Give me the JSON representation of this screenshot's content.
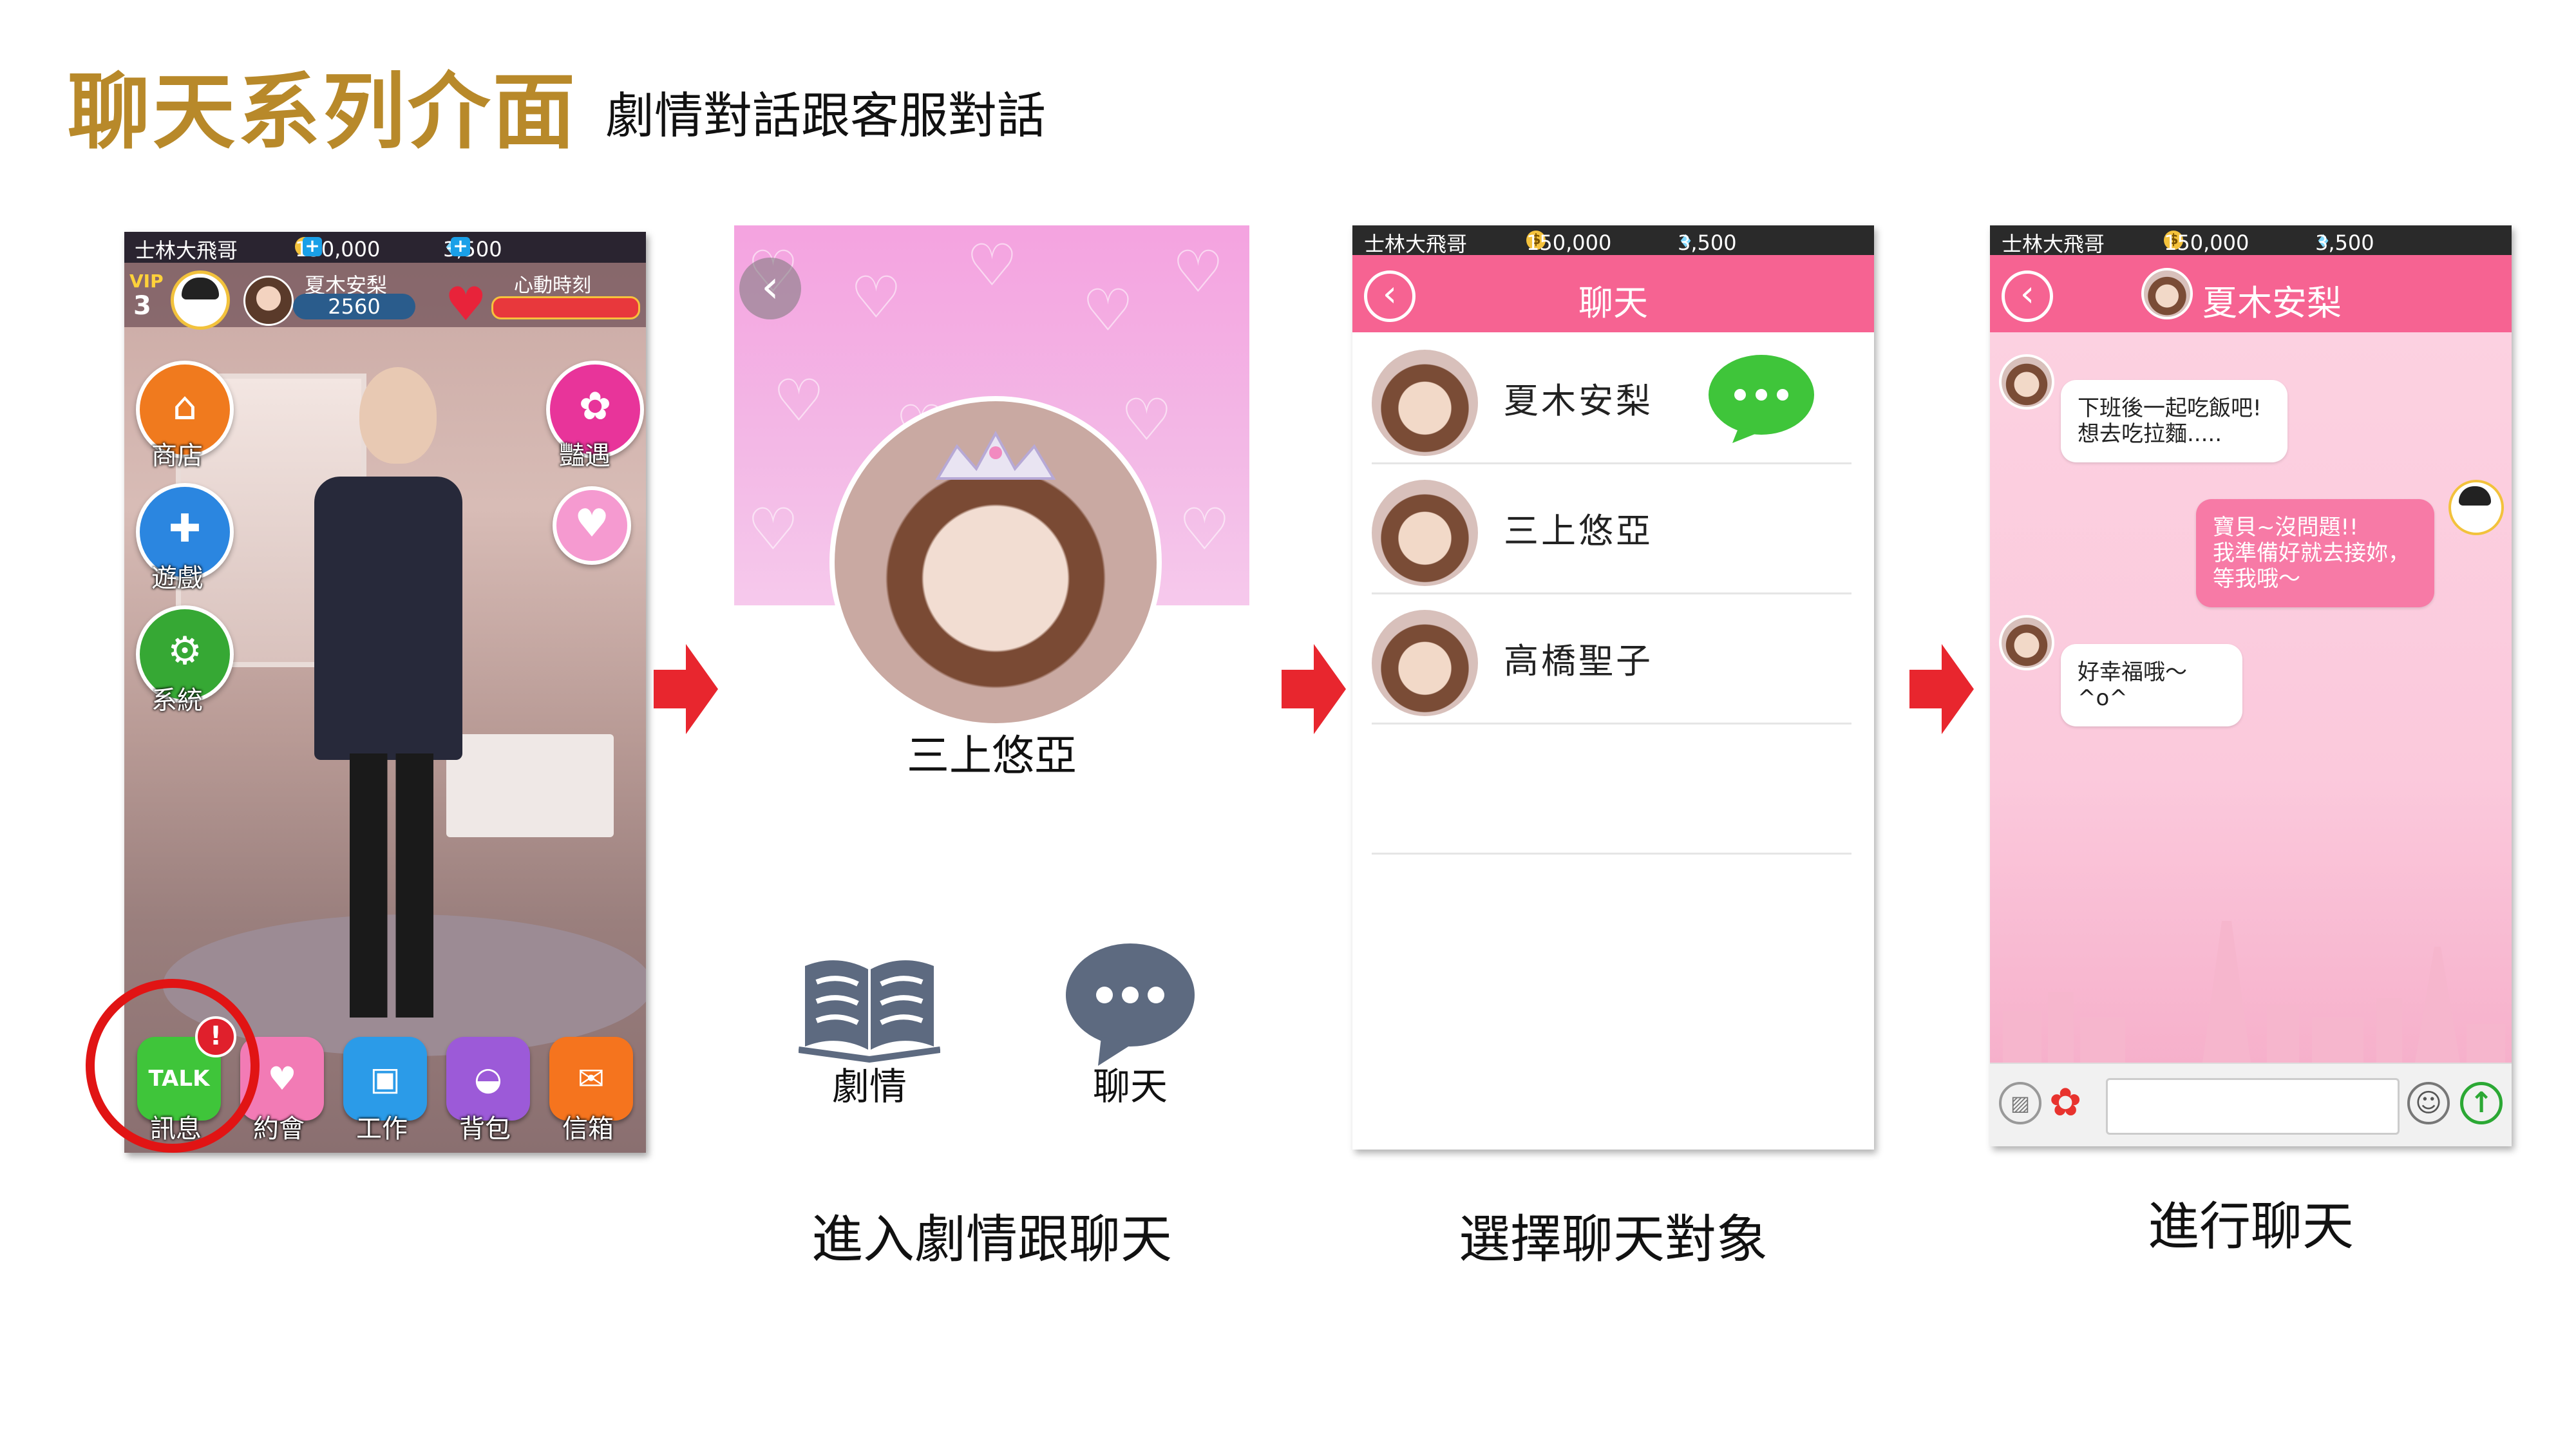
{
  "title": "聊天系列介面",
  "subtitle": "劇情對話跟客服對話",
  "status": {
    "player": "士林大飛哥",
    "coins": "150,000",
    "gems": "3,500"
  },
  "home": {
    "vip_label": "VIP",
    "vip_level": "3",
    "heroine_name": "夏木安梨",
    "heroine_score": "2560",
    "love_label": "心動時刻",
    "side_buttons": [
      "商店",
      "遊戲",
      "系統",
      "豔遇"
    ],
    "dock": [
      "訊息",
      "約會",
      "工作",
      "背包",
      "信箱"
    ],
    "talk_icon": "TALK",
    "badge": "!"
  },
  "profile": {
    "name": "三上悠亞",
    "story_label": "劇情",
    "chat_label": "聊天"
  },
  "captions": [
    "進入劇情跟聊天",
    "選擇聊天對象",
    "進行聊天"
  ],
  "chat_list": {
    "title": "聊天",
    "contacts": [
      "夏木安梨",
      "三上悠亞",
      "高橋聖子"
    ]
  },
  "conversation": {
    "title": "夏木安梨",
    "messages": [
      {
        "from": "her",
        "lines": [
          "下班後一起吃飯吧!",
          "想去吃拉麵....."
        ]
      },
      {
        "from": "me",
        "lines": [
          "寶貝~沒問題!!",
          "我準備好就去接妳，",
          "等我哦～"
        ]
      },
      {
        "from": "her",
        "lines": [
          "好幸福哦～^o^"
        ]
      }
    ]
  },
  "colors": {
    "title_gold": "#b8892a",
    "pink_bar": "#f66392",
    "arrow_red": "#e8262e",
    "line_green": "#3fc53a"
  }
}
